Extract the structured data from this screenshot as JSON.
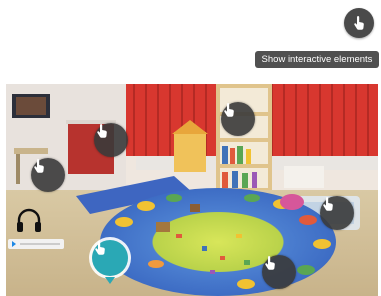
{
  "toggle": {
    "icon": "hand-pointer-icon",
    "tooltip": "Show interactive elements"
  },
  "scene": {
    "hotspots": [
      {
        "icon": "hand-pointer-icon"
      },
      {
        "icon": "hand-pointer-icon"
      },
      {
        "icon": "hand-pointer-icon"
      },
      {
        "icon": "hand-pointer-icon"
      },
      {
        "icon": "hand-pointer-icon"
      },
      {
        "icon": "hand-pointer-icon",
        "active": true
      },
      {
        "icon": "hand-pointer-icon"
      }
    ],
    "audio": {
      "icon": "headphones-icon"
    }
  },
  "colors": {
    "hotspot": "#3a3a3a",
    "hotspot_active": "#2aa8b5",
    "tooltip_bg": "#505050"
  }
}
